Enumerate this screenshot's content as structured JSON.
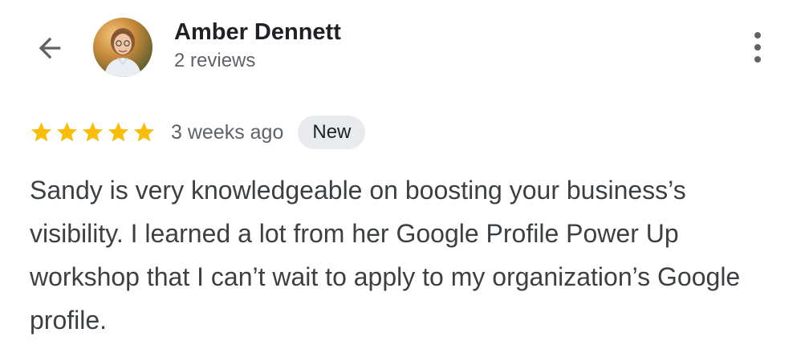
{
  "header": {
    "back_icon": "arrow-left-icon",
    "reviewer_name": "Amber Dennett",
    "review_count": "2 reviews",
    "more_icon": "more-vert-icon"
  },
  "review": {
    "rating": 5,
    "rating_max": 5,
    "time_ago": "3 weeks ago",
    "badge": "New",
    "text": "Sandy is very knowledgeable on boosting your business’s visibility. I learned a lot from her Google Profile Power Up workshop that I can’t wait to apply to my organization’s Google profile."
  },
  "colors": {
    "star": "#fbbc04",
    "badge_bg": "#e8eaed",
    "text": "#3c4043",
    "secondary": "#5f6368"
  }
}
